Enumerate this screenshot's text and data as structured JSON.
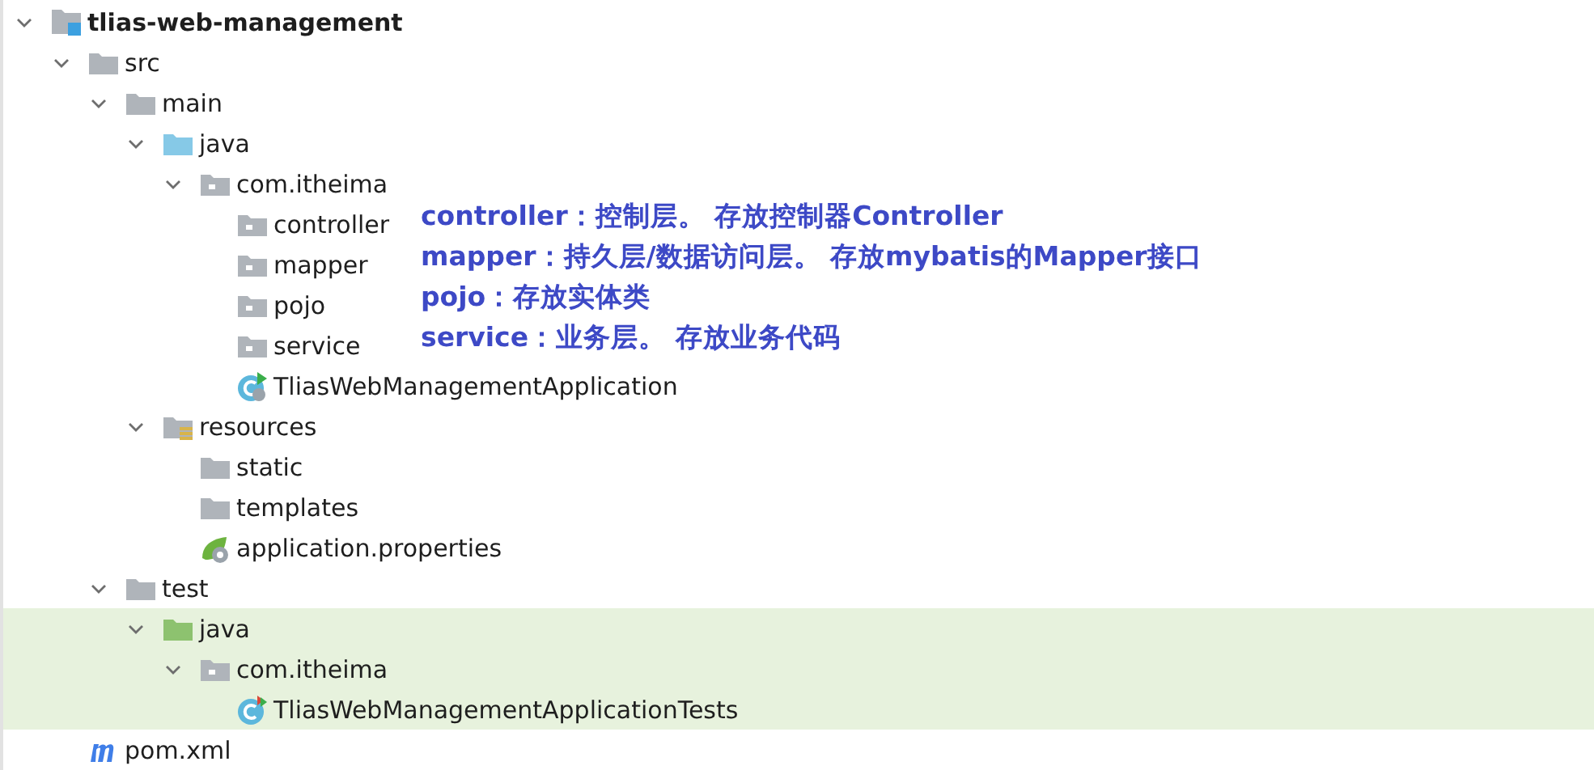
{
  "tree": [
    {
      "name": "tlias-web-management",
      "kind": "module",
      "expanded": true,
      "highlighted": false,
      "children": [
        {
          "name": "src",
          "kind": "folder",
          "expanded": true,
          "highlighted": false,
          "children": [
            {
              "name": "main",
              "kind": "folder",
              "expanded": true,
              "highlighted": false,
              "children": [
                {
                  "name": "java",
                  "kind": "source-folder",
                  "expanded": true,
                  "highlighted": false,
                  "children": [
                    {
                      "name": "com.itheima",
                      "kind": "package",
                      "expanded": true,
                      "highlighted": false,
                      "children": [
                        {
                          "name": "controller",
                          "kind": "package",
                          "highlighted": false
                        },
                        {
                          "name": "mapper",
                          "kind": "package",
                          "highlighted": false
                        },
                        {
                          "name": "pojo",
                          "kind": "package",
                          "highlighted": false
                        },
                        {
                          "name": "service",
                          "kind": "package",
                          "highlighted": false
                        },
                        {
                          "name": "TliasWebManagementApplication",
                          "kind": "spring-class",
                          "highlighted": false
                        }
                      ]
                    }
                  ]
                },
                {
                  "name": "resources",
                  "kind": "resources-folder",
                  "expanded": true,
                  "highlighted": false,
                  "children": [
                    {
                      "name": "static",
                      "kind": "folder",
                      "highlighted": false
                    },
                    {
                      "name": "templates",
                      "kind": "folder",
                      "highlighted": false
                    },
                    {
                      "name": "application.properties",
                      "kind": "spring-config",
                      "highlighted": false
                    }
                  ]
                }
              ]
            },
            {
              "name": "test",
              "kind": "folder",
              "expanded": true,
              "highlighted": false,
              "children": [
                {
                  "name": "java",
                  "kind": "test-folder",
                  "expanded": true,
                  "highlighted": true,
                  "children": [
                    {
                      "name": "com.itheima",
                      "kind": "package",
                      "expanded": true,
                      "highlighted": true,
                      "children": [
                        {
                          "name": "TliasWebManagementApplicationTests",
                          "kind": "test-class",
                          "highlighted": true
                        }
                      ]
                    }
                  ]
                }
              ]
            }
          ]
        },
        {
          "name": "pom.xml",
          "kind": "maven",
          "highlighted": false
        }
      ]
    }
  ],
  "notes": [
    "controller：控制层。 存放控制器Controller",
    "mapper：持久层/数据访问层。 存放mybatis的Mapper接口",
    "pojo：存放实体类",
    "service：业务层。 存放业务代码"
  ]
}
